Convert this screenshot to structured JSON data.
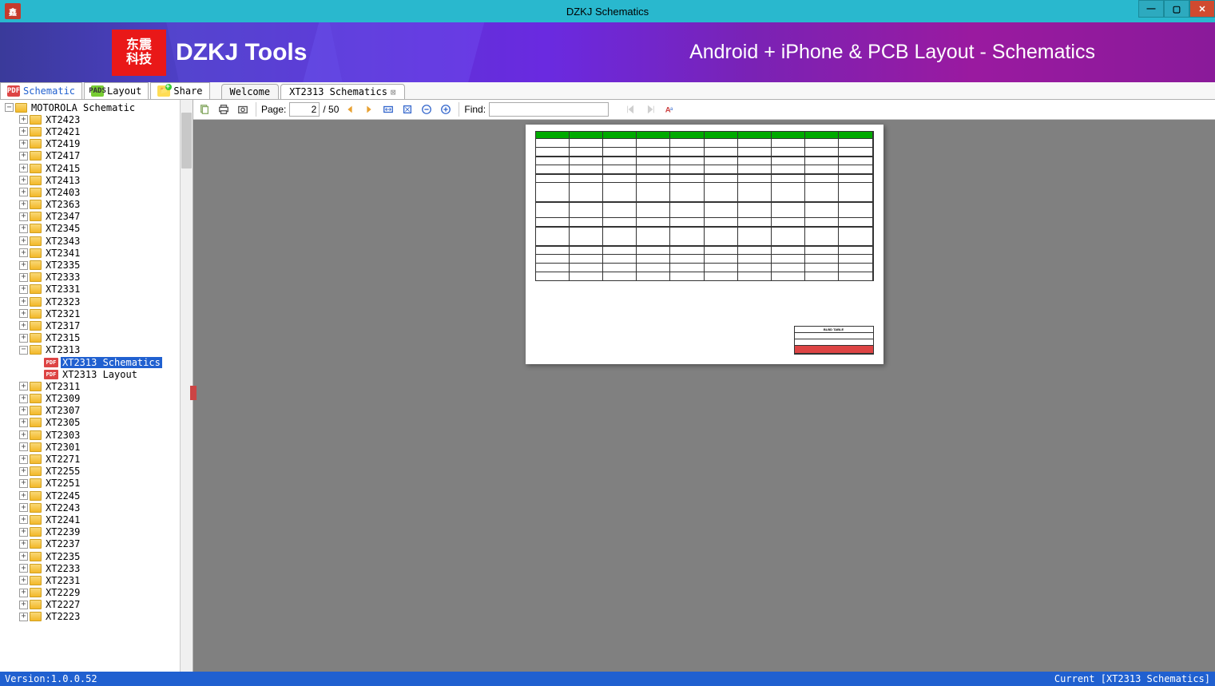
{
  "window": {
    "title": "DZKJ Schematics"
  },
  "banner": {
    "logo_text": "东震\n科技",
    "brand": "DZKJ Tools",
    "tagline": "Android + iPhone & PCB Layout - Schematics"
  },
  "panel_tabs": {
    "schematic": "Schematic",
    "layout": "Layout",
    "share": "Share"
  },
  "doc_tabs": [
    {
      "label": "Welcome",
      "active": false,
      "closable": false
    },
    {
      "label": "XT2313 Schematics",
      "active": true,
      "closable": true
    }
  ],
  "tree": {
    "root": "MOTOROLA Schematic",
    "folders": [
      "XT2423",
      "XT2421",
      "XT2419",
      "XT2417",
      "XT2415",
      "XT2413",
      "XT2403",
      "XT2363",
      "XT2347",
      "XT2345",
      "XT2343",
      "XT2341",
      "XT2335",
      "XT2333",
      "XT2331",
      "XT2323",
      "XT2321",
      "XT2317",
      "XT2315"
    ],
    "expanded_folder": "XT2313",
    "expanded_children": [
      {
        "label": "XT2313 Schematics",
        "selected": true
      },
      {
        "label": "XT2313 Layout",
        "selected": false
      }
    ],
    "folders_after": [
      "XT2311",
      "XT2309",
      "XT2307",
      "XT2305",
      "XT2303",
      "XT2301",
      "XT2271",
      "XT2255",
      "XT2251",
      "XT2245",
      "XT2243",
      "XT2241",
      "XT2239",
      "XT2237",
      "XT2235",
      "XT2233",
      "XT2231",
      "XT2229",
      "XT2227",
      "XT2223"
    ]
  },
  "toolbar": {
    "page_label": "Page:",
    "page_current": "2",
    "page_total": "/ 50",
    "find_label": "Find:",
    "find_value": ""
  },
  "document": {
    "titleblock_title": "BLBD TABLE"
  },
  "statusbar": {
    "version": "Version:1.0.0.52",
    "current": "Current [XT2313 Schematics]"
  }
}
